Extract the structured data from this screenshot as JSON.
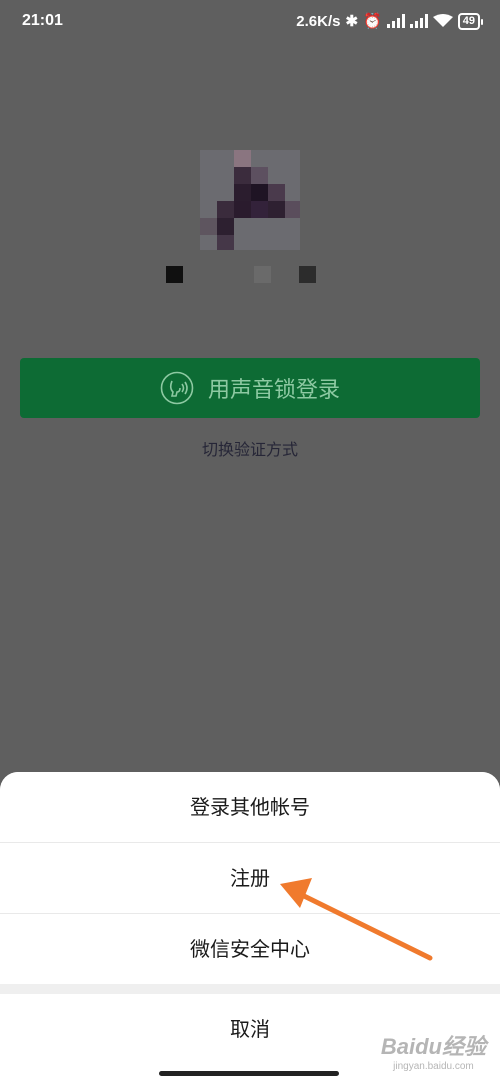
{
  "status_bar": {
    "time": "21:01",
    "speed": "2.6K/s",
    "battery": "49"
  },
  "login": {
    "voice_button_label": "用声音锁登录",
    "switch_method_label": "切换验证方式"
  },
  "action_sheet": {
    "items": [
      "登录其他帐号",
      "注册",
      "微信安全中心"
    ],
    "cancel_label": "取消"
  },
  "colors": {
    "background_dim": "#5f5f5f",
    "voice_button_bg": "#0d6b34",
    "voice_button_text": "#8dc9a2",
    "sheet_bg": "#ffffff",
    "arrow": "#f07a2d"
  },
  "watermark": {
    "line1": "Baidu经验",
    "line2": "jingyan.baidu.com"
  }
}
